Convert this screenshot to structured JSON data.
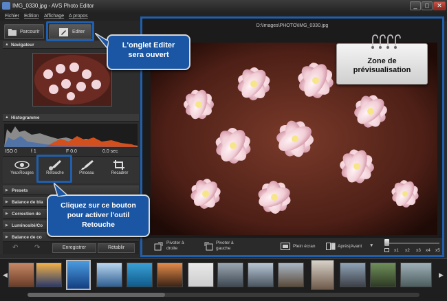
{
  "window": {
    "title": "IMG_0330.jpg - AVS Photo Editor"
  },
  "menu": [
    {
      "label": "Fichier"
    },
    {
      "label": "Edition"
    },
    {
      "label": "Affichage"
    },
    {
      "label": "A propos"
    }
  ],
  "tabs": {
    "browse": "Parcourir",
    "edit": "Editer"
  },
  "sections": {
    "navigator": "Navigateur",
    "histogram": "Histogramme"
  },
  "histogram_info": {
    "iso": "ISO 0",
    "f": "f 1",
    "fstop": "F 0.0",
    "sec": "0.0 sec"
  },
  "tools": [
    {
      "label": "YeuxRouges",
      "icon": "eye-icon"
    },
    {
      "label": "Retouche",
      "icon": "brush-icon"
    },
    {
      "label": "Pinceau",
      "icon": "paintbrush-icon"
    },
    {
      "label": "Recadrer",
      "icon": "crop-icon"
    }
  ],
  "panel_items": [
    {
      "label": "Presets"
    },
    {
      "label": "Balance de bla"
    },
    {
      "label": "Correction de"
    },
    {
      "label": "Luminosité/Co"
    },
    {
      "label": "Balance de co"
    }
  ],
  "actions": {
    "save": "Enregistrer",
    "reset": "Rétablir"
  },
  "preview": {
    "file_path": "D:\\Images\\PHOTO\\IMG_0330.jpg"
  },
  "bottombar": {
    "rotate_right": "Pivoter à\ndroite",
    "rotate_left": "Pivoter à\ngauche",
    "fullscreen": "Plein écran",
    "before_after": "Après|Avant",
    "zoom_levels": [
      "x1",
      "x2",
      "x3",
      "x4",
      "x5"
    ]
  },
  "callouts": {
    "edit_tab": "L'onglet Editer\nsera ouvert",
    "preview_zone": "Zone de\nprévisualisation",
    "retouch": "Cliquez sur ce bouton\npour activer l'outil\nRetouche"
  },
  "colors": {
    "accent": "#1f5fad",
    "callout_bg": "#1a56a4"
  }
}
